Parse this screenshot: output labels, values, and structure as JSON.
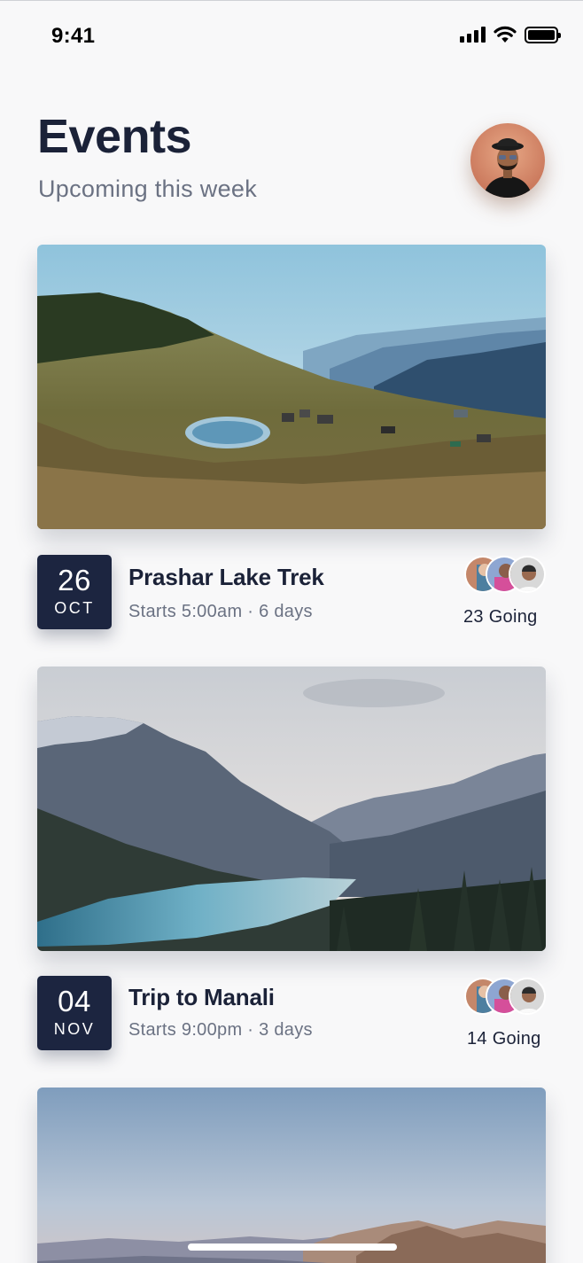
{
  "status_bar": {
    "time": "9:41"
  },
  "header": {
    "title": "Events",
    "subtitle": "Upcoming this week"
  },
  "events": [
    {
      "day": "26",
      "month": "OCT",
      "title": "Prashar Lake Trek",
      "meta": "Starts 5:00am · 6 days",
      "going": "23 Going"
    },
    {
      "day": "04",
      "month": "NOV",
      "title": "Trip to Manali",
      "meta": "Starts 9:00pm · 3 days",
      "going": "14 Going"
    }
  ],
  "colors": {
    "accent": "#1c2540",
    "text": "#1b2238",
    "muted": "#6b7283",
    "background": "#f8f8f9"
  }
}
